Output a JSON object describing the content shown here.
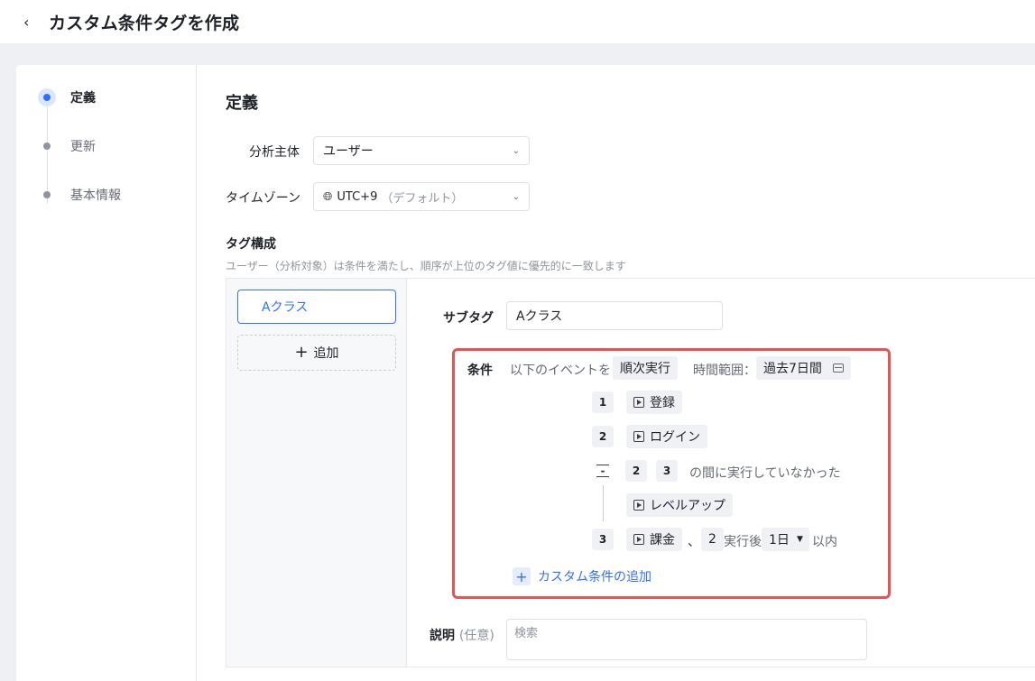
{
  "header": {
    "back_icon": "chevron-left-icon",
    "title": "カスタム条件タグを作成"
  },
  "steps": [
    {
      "label": "定義",
      "active": true
    },
    {
      "label": "更新",
      "active": false
    },
    {
      "label": "基本情報",
      "active": false
    }
  ],
  "definition": {
    "section_title": "定義",
    "subject_label": "分析主体",
    "subject_value": "ユーザー",
    "timezone_label": "タイムゾーン",
    "timezone_value": "UTC+9",
    "timezone_suffix": "（デフォルト）",
    "tag_structure_title": "タグ構成",
    "tag_structure_desc": "ユーザー（分析対象）は条件を満たし、順序が上位のタグ値に優先的に一致します"
  },
  "tags": {
    "items": [
      "Aクラス"
    ],
    "add_label": "追加"
  },
  "subtag": {
    "label": "サブタグ",
    "value": "Aクラス"
  },
  "condition": {
    "label": "条件",
    "intro": "以下のイベントを",
    "order_mode": "順次実行",
    "time_range_label": "時間範囲：",
    "time_range_value": "過去7日間",
    "events": [
      {
        "index": "1",
        "name": "登録"
      },
      {
        "index": "2",
        "name": "ログイン"
      },
      {
        "index": "3",
        "name": "課金"
      }
    ],
    "exclusion": {
      "from": "2",
      "to": "3",
      "text": "の間に実行していなかった",
      "event": "レベルアップ"
    },
    "within": {
      "separator": "、",
      "count": "2",
      "after_text": "実行後",
      "period": "1日",
      "suffix": "以内"
    },
    "add_label": "カスタム条件の追加"
  },
  "description": {
    "label": "説明",
    "optional": "(任意)",
    "placeholder": "検索"
  }
}
